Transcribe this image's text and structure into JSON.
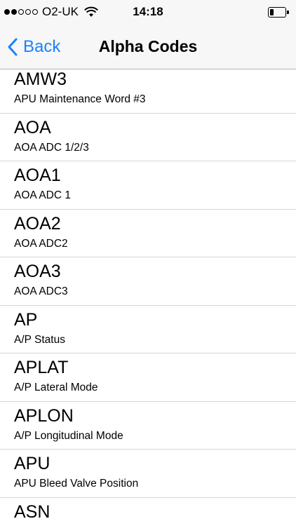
{
  "status_bar": {
    "signal_bars_filled": 2,
    "signal_bars_total": 5,
    "carrier": "O2-UK",
    "time": "14:18",
    "wifi_icon": "wifi-icon",
    "battery_icon": "battery-low-icon"
  },
  "nav": {
    "back_label": "Back",
    "title": "Alpha Codes",
    "accent_color": "#1a82fb"
  },
  "items": [
    {
      "code": "AMW3",
      "description": "APU Maintenance Word #3"
    },
    {
      "code": "AOA",
      "description": "AOA ADC 1/2/3"
    },
    {
      "code": "AOA1",
      "description": "AOA ADC 1"
    },
    {
      "code": "AOA2",
      "description": "AOA ADC2"
    },
    {
      "code": "AOA3",
      "description": "AOA ADC3"
    },
    {
      "code": "AP",
      "description": "A/P Status"
    },
    {
      "code": "APLAT",
      "description": "A/P Lateral Mode"
    },
    {
      "code": "APLON",
      "description": "A/P Longitudinal Mode"
    },
    {
      "code": "APU",
      "description": "APU Bleed Valve Position"
    },
    {
      "code": "ASN",
      "description": ""
    }
  ]
}
